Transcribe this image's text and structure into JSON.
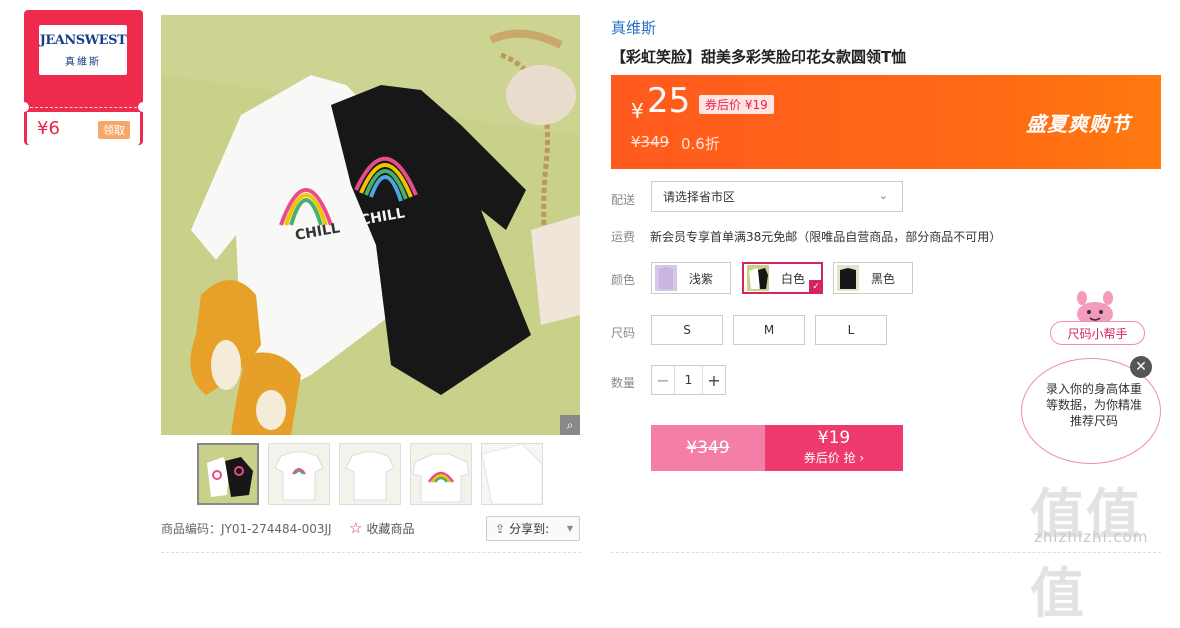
{
  "coupon": {
    "brand_logo_en": "JEANSWEST",
    "brand_logo_cn": "真維斯",
    "amount": "¥6",
    "claim_label": "领取"
  },
  "gallery": {
    "main_shirt_text_left": "CHILL",
    "main_shirt_text_right": "CHILL",
    "zoom_icon": "magnifier-icon",
    "thumbnails": [
      "thumb-1",
      "thumb-2",
      "thumb-3",
      "thumb-4",
      "thumb-5"
    ],
    "sku_label": "商品编码：JY01-274484-003JJ",
    "favorite_label": "收藏商品",
    "share_label": "分享到:"
  },
  "product": {
    "brand": "真维斯",
    "title": "【彩虹笑脸】甜美多彩笑脸印花女款圆领T恤"
  },
  "price": {
    "currency": "¥",
    "current": "25",
    "after_coupon": "券后价 ¥19",
    "original": "¥349",
    "discount": "0.6折",
    "promo": "盛夏爽购节"
  },
  "shipping": {
    "label": "配送",
    "select_placeholder": "请选择省市区",
    "freight_label": "运费",
    "freight_text": "新会员专享首单满38元免邮（限唯品自营商品，部分商品不可用）"
  },
  "colors": {
    "label": "颜色",
    "options": [
      "浅紫",
      "白色",
      "黑色"
    ],
    "selected": "白色"
  },
  "sizes": {
    "label": "尺码",
    "options": [
      "S",
      "M",
      "L"
    ]
  },
  "quantity": {
    "label": "数量",
    "value": "1",
    "minus": "−",
    "plus": "+"
  },
  "buy": {
    "original": "¥349",
    "price": "¥19",
    "label": "券后价 抢 ›"
  },
  "size_helper": {
    "button_label": "尺码小帮手",
    "bubble_text": "录入你的身高体重等数据，为你精准推荐尺码",
    "close": "✕"
  },
  "watermark": {
    "big": "值值值",
    "url": "zhizhizhi.com"
  },
  "colors_theme": {
    "accent_red": "#ee2a4d",
    "price_orange": "#ff5a1e",
    "brand_blue": "#2572c8",
    "pink": "#ee3b6d"
  }
}
